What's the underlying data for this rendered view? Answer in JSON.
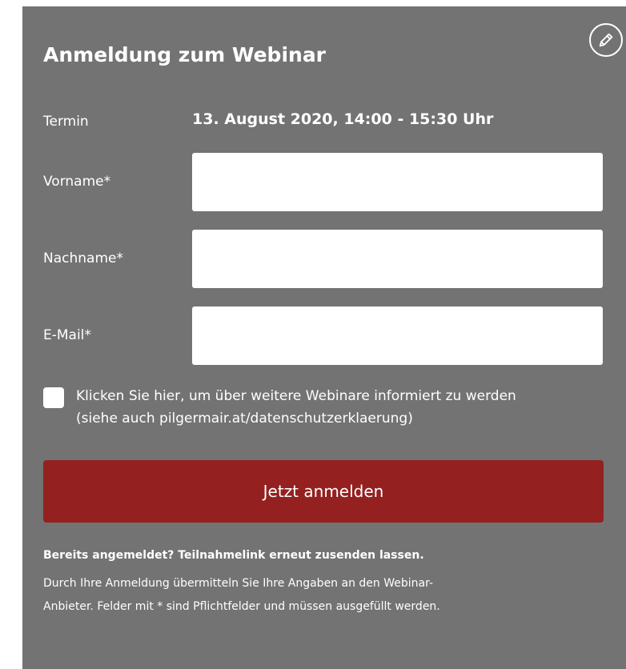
{
  "form": {
    "title": "Anmeldung zum Webinar",
    "termin_label": "Termin",
    "termin_value": "13. August 2020, 14:00 - 15:30 Uhr",
    "fields": [
      {
        "label": "Vorname*",
        "value": "",
        "placeholder": ""
      },
      {
        "label": "Nachname*",
        "value": "",
        "placeholder": ""
      },
      {
        "label": "E-Mail*",
        "value": "",
        "placeholder": ""
      }
    ],
    "newsletter": {
      "checked": false,
      "line1": "Klicken Sie hier, um über weitere Webinare informiert zu werden",
      "line2": "(siehe auch pilgermair.at/datenschutzerklaerung)"
    },
    "submit_label": "Jetzt anmelden",
    "resend_text": "Bereits angemeldet? Teilnahmelink erneut zusenden lassen.",
    "info_line1": "Durch Ihre Anmeldung übermitteln Sie Ihre Angaben an den Webinar-",
    "info_line2": "Anbieter. Felder mit * sind Pflichtfelder und müssen ausgefüllt werden."
  },
  "icons": {
    "edit": "pencil-icon"
  },
  "colors": {
    "panel_bg": "#737373",
    "submit_bg": "#942020",
    "text": "#ffffff",
    "field_bg": "#ffffff"
  }
}
